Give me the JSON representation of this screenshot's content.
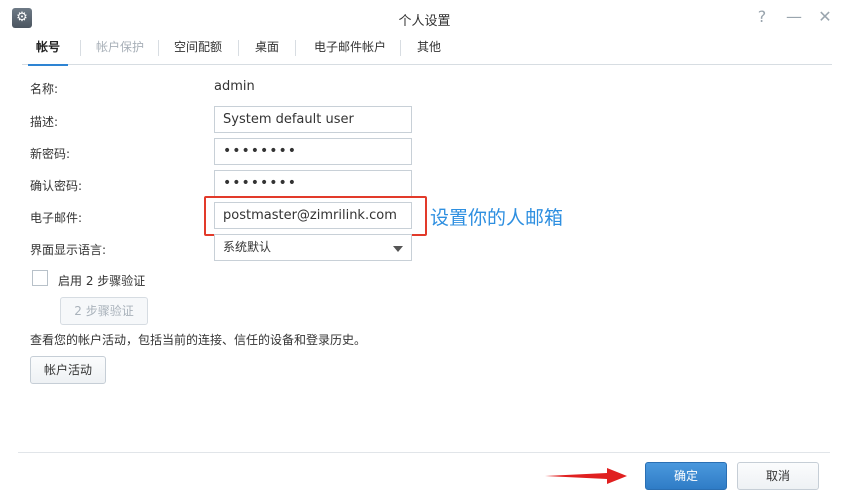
{
  "window": {
    "title": "个人设置",
    "help_icon": "?",
    "minimize_icon": "—",
    "close_icon": "✕"
  },
  "tabs": [
    {
      "label": "帐号",
      "state": "active"
    },
    {
      "label": "帐户保护",
      "state": "disabled"
    },
    {
      "label": "空间配额",
      "state": "normal"
    },
    {
      "label": "桌面",
      "state": "normal"
    },
    {
      "label": "电子邮件帐户",
      "state": "normal"
    },
    {
      "label": "其他",
      "state": "normal"
    }
  ],
  "form": {
    "name_label": "名称:",
    "name_value": "admin",
    "description_label": "描述:",
    "description_value": "System default user",
    "new_password_label": "新密码:",
    "new_password_value": "••••••••",
    "confirm_password_label": "确认密码:",
    "confirm_password_value": "••••••••",
    "email_label": "电子邮件:",
    "email_value": "postmaster@zimrilink.com",
    "language_label": "界面显示语言:",
    "language_value": "系统默认",
    "two_step_checkbox_label": "启用 2 步骤验证",
    "two_step_checked": false,
    "two_step_button": "2 步骤验证",
    "activity_hint": "查看您的帐户活动，包括当前的连接、信任的设备和登录历史。",
    "activity_button": "帐户活动"
  },
  "annotation": {
    "text": "设置你的人邮箱",
    "color": "#2e8fe0",
    "box_color": "#e23a2a"
  },
  "footer": {
    "ok_button": "确定",
    "cancel_button": "取消"
  },
  "colors": {
    "accent": "#2e84d3",
    "primary_button": "#3a88d1"
  }
}
